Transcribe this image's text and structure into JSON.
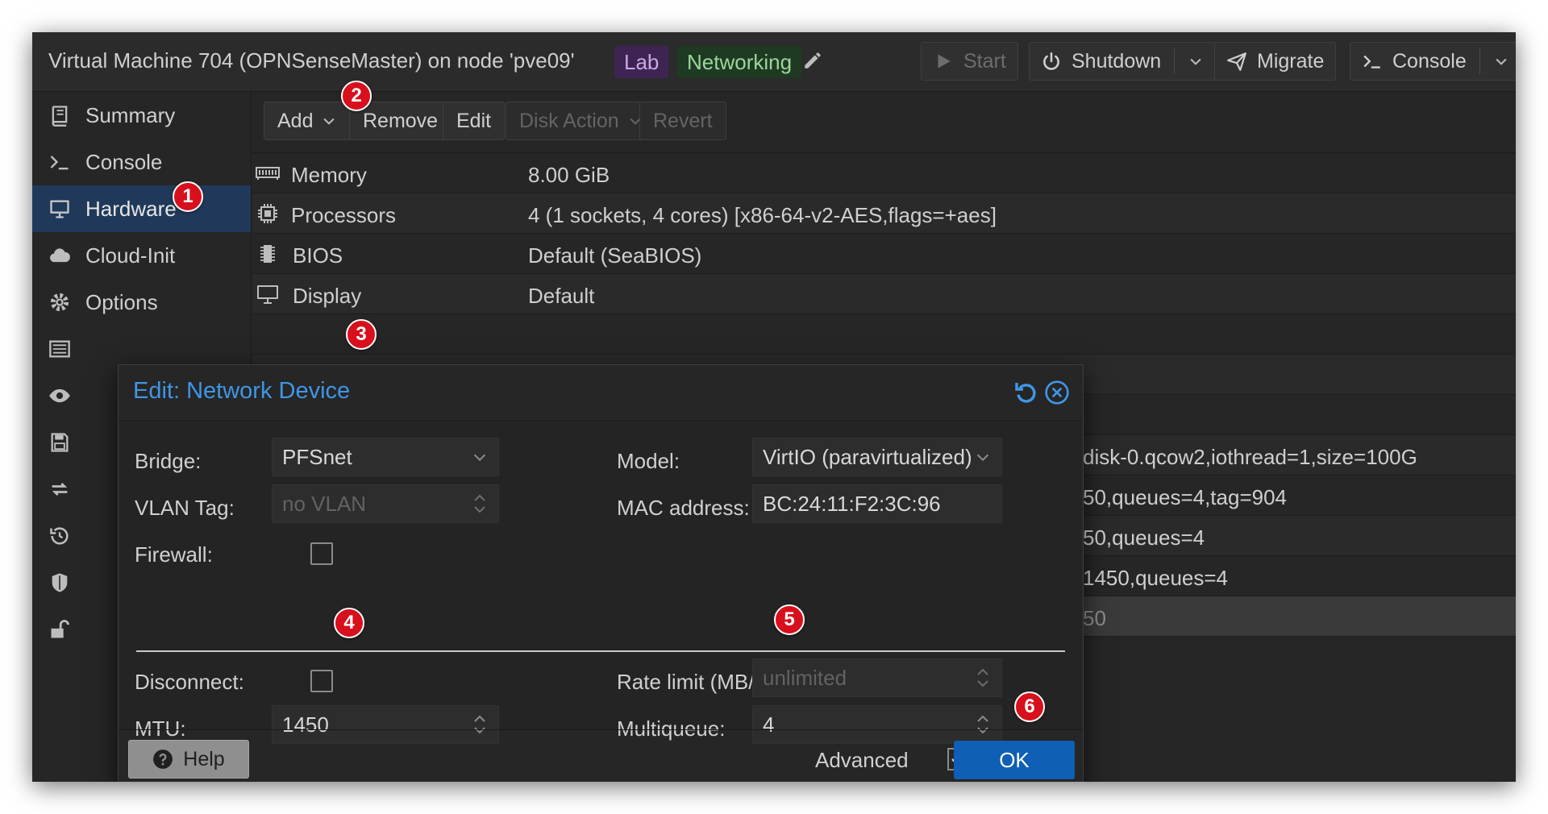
{
  "window": {
    "title": "Virtual Machine 704 (OPNSenseMaster) on node 'pve09'",
    "tags": [
      "Lab",
      "Networking"
    ],
    "buttons": {
      "start": "Start",
      "shutdown": "Shutdown",
      "migrate": "Migrate",
      "console": "Console"
    }
  },
  "sidebar": {
    "items": [
      {
        "label": "Summary",
        "icon": "book-icon"
      },
      {
        "label": "Console",
        "icon": "terminal-icon"
      },
      {
        "label": "Hardware",
        "icon": "monitor-icon",
        "active": true
      },
      {
        "label": "Cloud-Init",
        "icon": "cloud-icon"
      },
      {
        "label": "Options",
        "icon": "gear-icon"
      }
    ],
    "icon_only": [
      "task-history-icon",
      "monitor-eye-icon",
      "backup-icon",
      "replication-icon",
      "snapshots-icon",
      "firewall-icon",
      "permissions-icon"
    ]
  },
  "toolbar": {
    "add": "Add",
    "remove": "Remove",
    "edit": "Edit",
    "disk_action": "Disk Action",
    "revert": "Revert"
  },
  "hardware": {
    "rows": [
      {
        "name": "Memory",
        "value": "8.00 GiB",
        "icon": "memory-icon"
      },
      {
        "name": "Processors",
        "value": "4 (1 sockets, 4 cores) [x86-64-v2-AES,flags=+aes]",
        "icon": "cpu-icon"
      },
      {
        "name": "BIOS",
        "value": "Default (SeaBIOS)",
        "icon": "bios-chip-icon"
      },
      {
        "name": "Display",
        "value": "Default",
        "icon": "display-icon"
      }
    ],
    "partial_rows": [
      "disk-0.qcow2,iothread=1,size=100G",
      "50,queues=4,tag=904",
      "50,queues=4",
      "1450,queues=4",
      "50"
    ]
  },
  "dialog": {
    "title": "Edit: Network Device",
    "bridge_label": "Bridge:",
    "bridge_value": "PFSnet",
    "vlan_label": "VLAN Tag:",
    "vlan_placeholder": "no VLAN",
    "firewall_label": "Firewall:",
    "model_label": "Model:",
    "model_value": "VirtIO (paravirtualized)",
    "mac_label": "MAC address:",
    "mac_value": "BC:24:11:F2:3C:96",
    "disconnect_label": "Disconnect:",
    "mtu_label": "MTU:",
    "mtu_value": "1450",
    "rate_label": "Rate limit (MB/s):",
    "rate_placeholder": "unlimited",
    "multiqueue_label": "Multiqueue:",
    "multiqueue_value": "4",
    "help": "Help",
    "advanced": "Advanced",
    "ok": "OK"
  },
  "callouts": [
    "1",
    "2",
    "3",
    "4",
    "5",
    "6"
  ],
  "colors": {
    "accent_blue": "#3f96e6",
    "ok_button": "#0e5fb5",
    "active_nav": "#20395a",
    "callout_red": "#d80f1c",
    "tag_lab": "#3e2452",
    "tag_networking": "#1f3a22"
  }
}
